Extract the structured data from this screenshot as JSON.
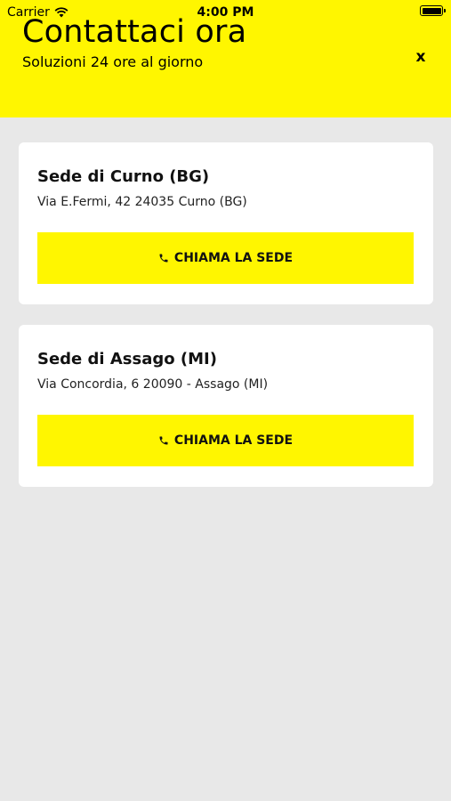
{
  "status_bar": {
    "carrier": "Carrier",
    "time": "4:00 PM"
  },
  "header": {
    "title": "Contattaci ora",
    "subtitle": "Soluzioni 24 ore al giorno",
    "close_label": "x"
  },
  "offices": [
    {
      "name": "Sede di Curno (BG)",
      "address": "Via E.Fermi, 42 24035 Curno (BG)",
      "button_label": "CHIAMA LA SEDE"
    },
    {
      "name": "Sede di Assago (MI)",
      "address": "Via Concordia, 6 20090 - Assago (MI)",
      "button_label": "CHIAMA LA SEDE"
    }
  ],
  "colors": {
    "accent": "#fff600",
    "background": "#e8e8e8",
    "card": "#ffffff"
  },
  "icons": {
    "wifi": "wifi-icon",
    "battery": "battery-icon",
    "phone": "phone-icon",
    "close": "close-icon"
  }
}
